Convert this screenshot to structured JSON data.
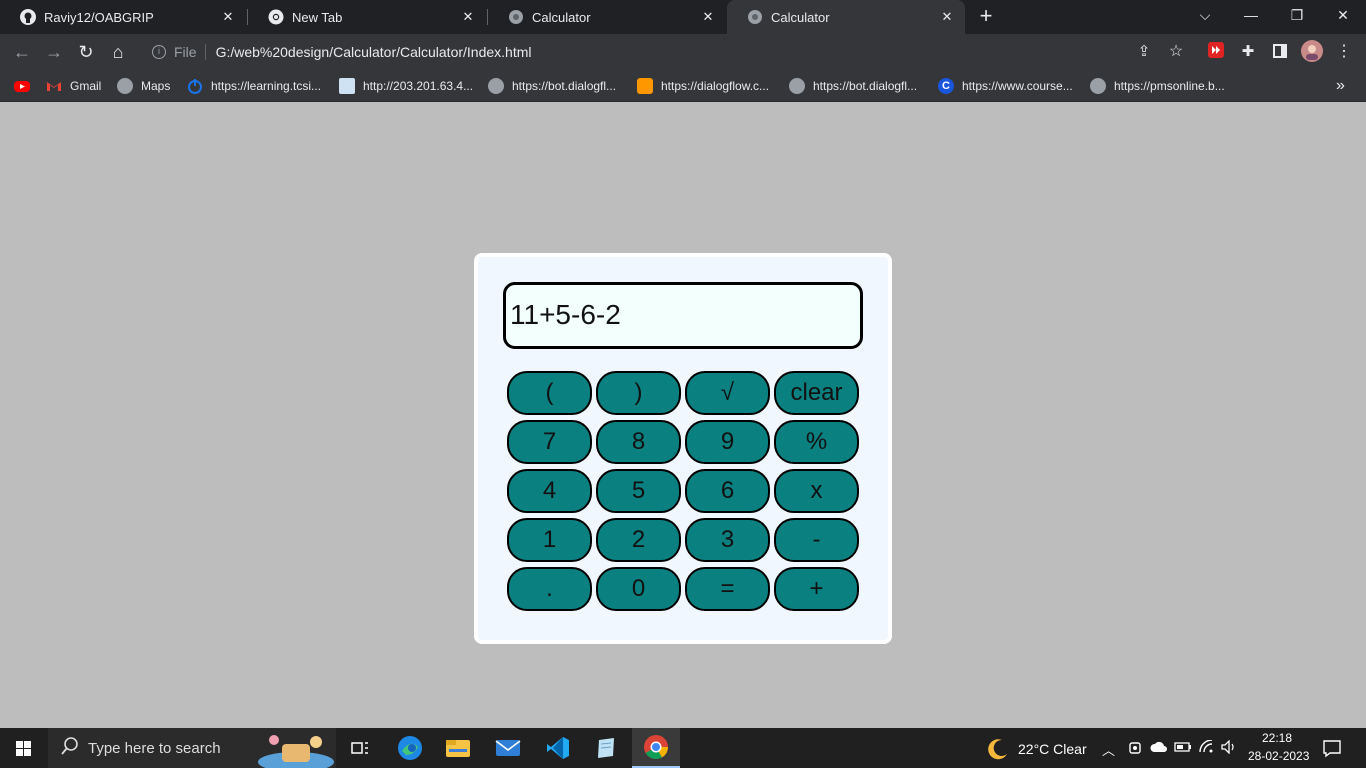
{
  "browser": {
    "tabs": [
      {
        "title": "Raviy12/OABGRIP",
        "icon": "github-icon"
      },
      {
        "title": "New Tab",
        "icon": "chrome-icon"
      },
      {
        "title": "Calculator",
        "icon": "globe-icon"
      },
      {
        "title": "Calculator",
        "icon": "globe-icon",
        "active": true
      }
    ],
    "address": {
      "scheme_label": "File",
      "url": "G:/web%20design/Calculator/Calculator/Index.html"
    },
    "bookmarks": [
      {
        "label": "",
        "icon": "youtube-icon"
      },
      {
        "label": "Gmail",
        "icon": "gmail-icon"
      },
      {
        "label": "Maps",
        "icon": "globe-icon"
      },
      {
        "label": "https://learning.tcsi...",
        "icon": "power-icon"
      },
      {
        "label": "http://203.201.63.4...",
        "icon": "image-icon"
      },
      {
        "label": "https://bot.dialogfl...",
        "icon": "globe-icon"
      },
      {
        "label": "https://dialogflow.c...",
        "icon": "dialogflow-icon"
      },
      {
        "label": "https://bot.dialogfl...",
        "icon": "globe-icon"
      },
      {
        "label": "https://www.course...",
        "icon": "coursera-icon"
      },
      {
        "label": "https://pmsonline.b...",
        "icon": "globe-icon"
      }
    ],
    "more_bookmarks": "»"
  },
  "calculator": {
    "display": "11+5-6-2",
    "keys": [
      [
        "(",
        ")",
        "√",
        "clear"
      ],
      [
        "7",
        "8",
        "9",
        "%"
      ],
      [
        "4",
        "5",
        "6",
        "x"
      ],
      [
        "1",
        "2",
        "3",
        "-"
      ],
      [
        ".",
        "0",
        "=",
        "+"
      ]
    ]
  },
  "taskbar": {
    "search_placeholder": "Type here to search",
    "weather": "22°C  Clear",
    "time": "22:18",
    "date": "28-02-2023"
  },
  "colors": {
    "page_bg": "#bdbdbd",
    "calc_bg": "#f0f7ff",
    "key_bg": "#0b8080",
    "display_bg": "#f2fffd"
  }
}
